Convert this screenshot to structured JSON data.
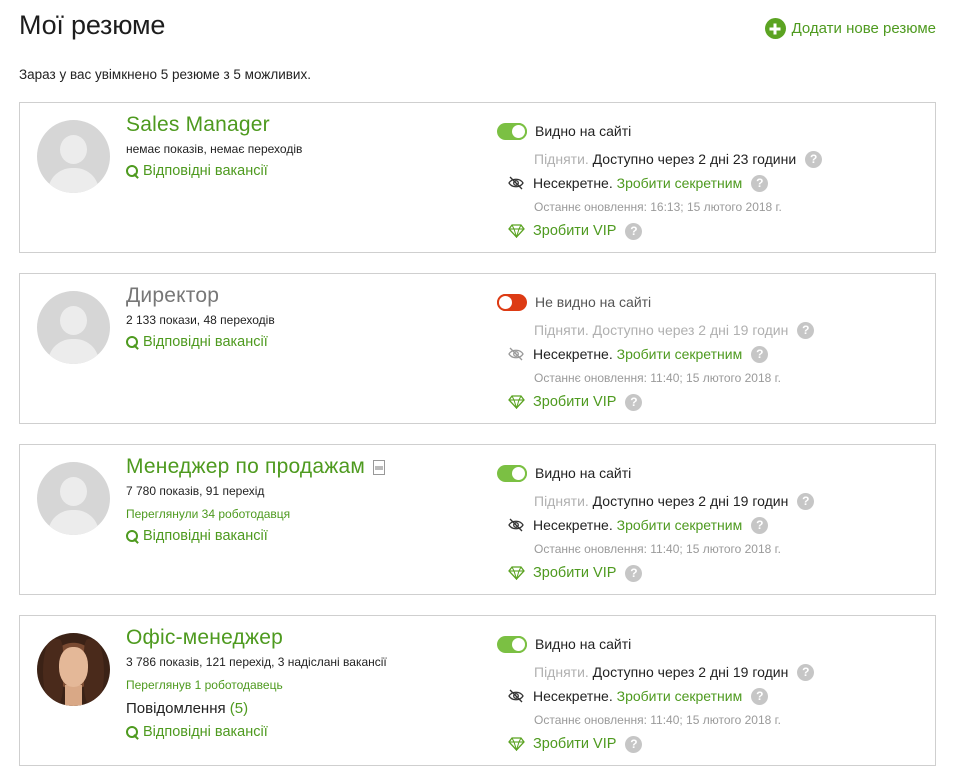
{
  "header": {
    "title": "Мої резюме",
    "add_label": "Додати нове резюме",
    "intro": "Зараз у вас увімкнено 5 резюме з 5 можливих."
  },
  "labels": {
    "raise": "Підняти.",
    "not_secret": "Несекретне.",
    "make_secret": "Зробити секретним",
    "make_vip": "Зробити VIP",
    "matching": "Відповідні вакансії",
    "help": "?"
  },
  "colors": {
    "accent": "#4e9a1f",
    "toggle_on": "#7bc043",
    "toggle_off": "#dd3b14"
  },
  "resumes": [
    {
      "title": "Sales Manager",
      "stats": "немає показів, немає переходів",
      "visibility": "Видно на сайті",
      "visible": true,
      "raise_info": "Доступно через 2 дні 23 години",
      "last_update": "Останнє оновлення: 16:13; 15 лютого 2018 г.",
      "avatar": "placeholder"
    },
    {
      "title": "Директор",
      "stats": "2 133 покази, 48 переходів",
      "visibility": "Не видно на сайті",
      "visible": false,
      "raise_info": "Доступно через 2 дні 19 годин",
      "last_update": "Останнє оновлення: 11:40; 15 лютого 2018 г.",
      "avatar": "placeholder"
    },
    {
      "title": "Менеджер по продажам",
      "stats": "7 780 показів, 91 перехід",
      "viewed": "Переглянули 34 роботодавця",
      "visibility": "Видно на сайті",
      "visible": true,
      "raise_info": "Доступно через 2 дні 19 годин",
      "last_update": "Останнє оновлення: 11:40; 15 лютого 2018 г.",
      "avatar": "placeholder"
    },
    {
      "title": "Офіс-менеджер",
      "stats": "3 786 показів, 121 перехід, 3 надіслані вакансії",
      "viewed": "Переглянув 1 роботодавець",
      "messages_label": "Повідомлення",
      "messages_count": "(5)",
      "visibility": "Видно на сайті",
      "visible": true,
      "raise_info": "Доступно через 2 дні 19 годин",
      "last_update": "Останнє оновлення: 11:40; 15 лютого 2018 г.",
      "avatar": "photo"
    }
  ]
}
